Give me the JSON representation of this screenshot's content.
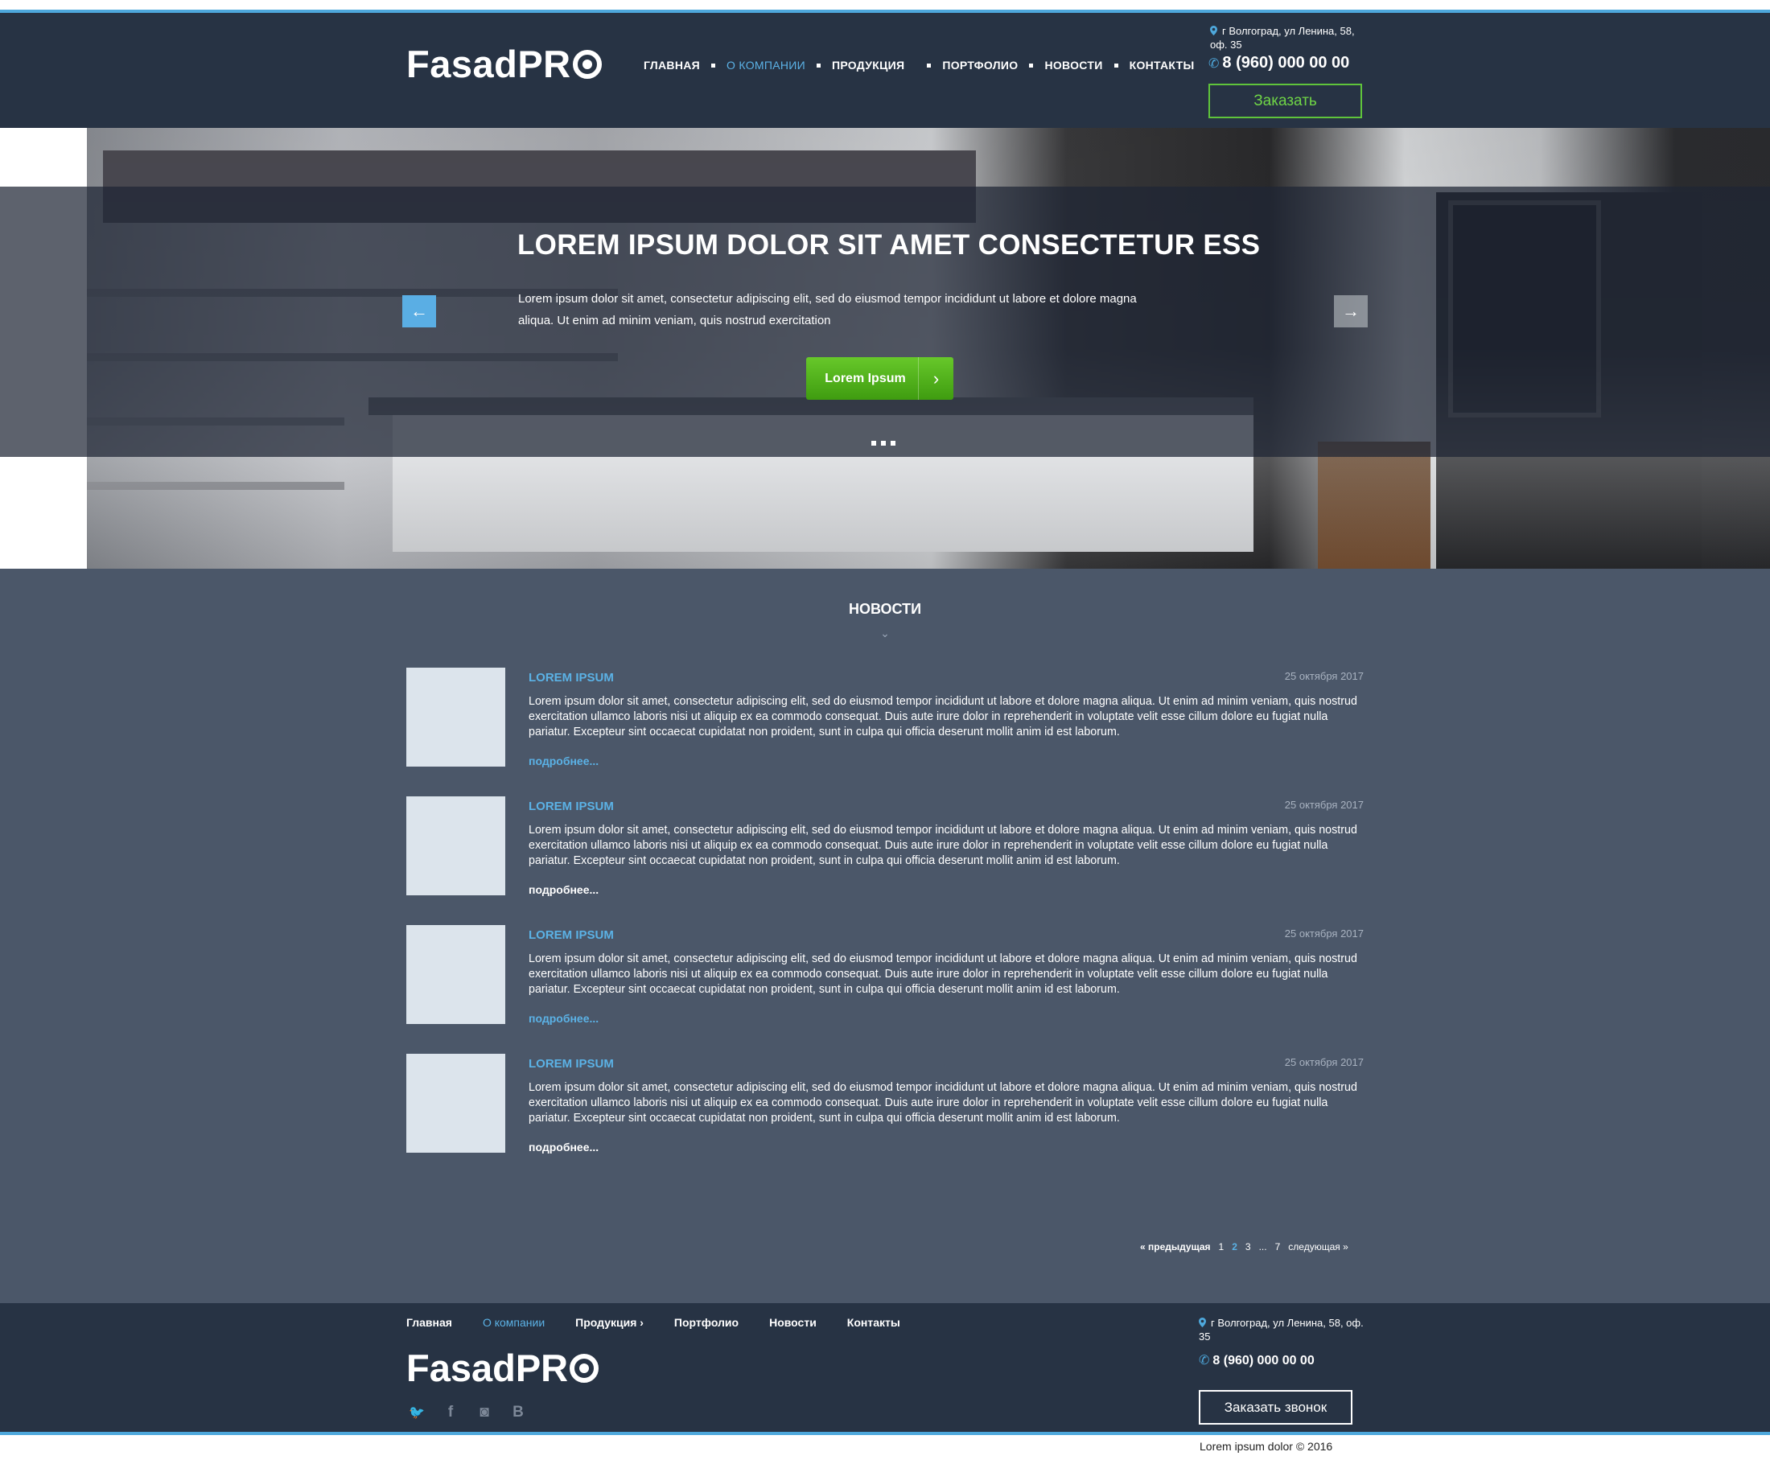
{
  "header": {
    "logo_main": "FasadPR",
    "nav": [
      "ГЛАВНАЯ",
      "О КОМПАНИИ",
      "ПРОДУКЦИЯ",
      "ПОРТФОЛИО",
      "НОВОСТИ",
      "КОНТАКТЫ"
    ],
    "active_nav": "О КОМПАНИИ",
    "address": "г Волгоград, ул Ленина, 58, оф. 35",
    "phone": "8 (960) 000 00 00",
    "order_label": "Заказать"
  },
  "hero": {
    "title": "LOREM IPSUM DOLOR SIT AMET CONSECTETUR ESS",
    "text": "Lorem ipsum dolor sit amet, consectetur adipiscing elit, sed do eiusmod tempor incididunt ut labore et dolore magna aliqua. Ut enim ad minim veniam, quis nostrud exercitation",
    "button_label": "Lorem Ipsum",
    "slides": 3
  },
  "news": {
    "heading": "НОВОСТИ",
    "items": [
      {
        "title": "LOREM IPSUM",
        "date": "25 октября 2017",
        "text": "Lorem ipsum dolor sit amet, consectetur adipiscing elit, sed do eiusmod tempor incididunt ut labore et dolore magna aliqua. Ut enim ad minim veniam, quis nostrud exercitation ullamco laboris nisi ut aliquip ex ea commodo consequat. Duis aute irure dolor in reprehenderit in voluptate velit esse cillum dolore eu fugiat nulla pariatur. Excepteur sint occaecat cupidatat non proident, sunt in culpa qui officia deserunt mollit anim id est laborum.",
        "more": "подробнее..."
      },
      {
        "title": "LOREM IPSUM",
        "date": "25 октября 2017",
        "text": "Lorem ipsum dolor sit amet, consectetur adipiscing elit, sed do eiusmod tempor incididunt ut labore et dolore magna aliqua. Ut enim ad minim veniam, quis nostrud exercitation ullamco laboris nisi ut aliquip ex ea commodo consequat. Duis aute irure dolor in reprehenderit in voluptate velit esse cillum dolore eu fugiat nulla pariatur. Excepteur sint occaecat cupidatat non proident, sunt in culpa qui officia deserunt mollit anim id est laborum.",
        "more": "подробнее..."
      },
      {
        "title": "LOREM IPSUM",
        "date": "25 октября 2017",
        "text": "Lorem ipsum dolor sit amet, consectetur adipiscing elit, sed do eiusmod tempor incididunt ut labore et dolore magna aliqua. Ut enim ad minim veniam, quis nostrud exercitation ullamco laboris nisi ut aliquip ex ea commodo consequat. Duis aute irure dolor in reprehenderit in voluptate velit esse cillum dolore eu fugiat nulla pariatur. Excepteur sint occaecat cupidatat non proident, sunt in culpa qui officia deserunt mollit anim id est laborum.",
        "more": "подробнее..."
      },
      {
        "title": "LOREM IPSUM",
        "date": "25 октября 2017",
        "text": "Lorem ipsum dolor sit amet, consectetur adipiscing elit, sed do eiusmod tempor incididunt ut labore et dolore magna aliqua. Ut enim ad minim veniam, quis nostrud exercitation ullamco laboris nisi ut aliquip ex ea commodo consequat. Duis aute irure dolor in reprehenderit in voluptate velit esse cillum dolore eu fugiat nulla pariatur. Excepteur sint occaecat cupidatat non proident, sunt in culpa qui officia deserunt mollit anim id est laborum.",
        "more": "подробнее..."
      }
    ]
  },
  "pager": {
    "prev": "« предыдущая",
    "pages": [
      "1",
      "2",
      "3",
      "...",
      "7"
    ],
    "current": "2",
    "next": "следующая »"
  },
  "footer": {
    "nav": [
      "Главная",
      "О компании",
      "Продукция  ›",
      "Портфолио",
      "Новости",
      "Контакты"
    ],
    "active_nav": "О компании",
    "logo_main": "FasadPR",
    "social": [
      "twitter-icon",
      "facebook-icon",
      "instagram-icon",
      "vk-icon"
    ],
    "social_glyphs": [
      "🐦",
      "f",
      "◙",
      "B"
    ],
    "address": "г Волгоград, ул Ленина, 58, оф. 35",
    "phone": "8 (960) 000 00 00",
    "call_label": "Заказать звонок",
    "copyright": "Lorem ipsum dolor © 2016"
  },
  "colors": {
    "header_bg": "#273344",
    "main_bg": "#4b5769",
    "accent_blue": "#5bb2e6",
    "accent_green": "#5fc43b"
  }
}
